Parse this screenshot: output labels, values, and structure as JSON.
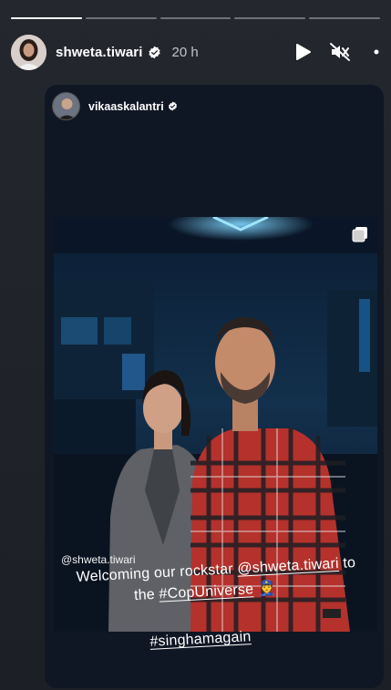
{
  "progress": {
    "segments": [
      {
        "fill": 1.0
      },
      {
        "fill": 0
      },
      {
        "fill": 0
      },
      {
        "fill": 0
      },
      {
        "fill": 0
      }
    ]
  },
  "header": {
    "username": "shweta.tiwari",
    "time": "20 h",
    "verified": true
  },
  "actions": {
    "play_icon": "play-icon",
    "mute_icon": "muted-speaker-icon",
    "more_icon": "more-icon"
  },
  "reshare": {
    "username": "vikaaskalantri",
    "verified": true,
    "mention_label": "@shweta.tiwari",
    "caption_line1_prefix": "Welcoming our rockstar ",
    "caption_line1_mention": "@shweta.tiwari",
    "caption_line1_suffix": " to",
    "caption_line2_prefix": "the ",
    "caption_line2_tag": "#CopUniverse",
    "caption_line2_emoji": "👮",
    "caption_line3_tag": "#singhamagain"
  },
  "colors": {
    "background": "#22252c",
    "card": "#0f1624",
    "verified_blue": "#0095f6"
  }
}
